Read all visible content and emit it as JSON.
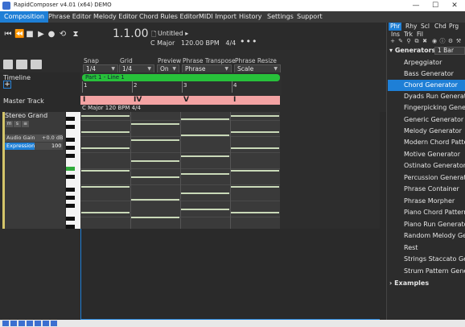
{
  "window": {
    "title": "RapidComposer v4.01 (x64) DEMO"
  },
  "menu": [
    {
      "label": "Composition"
    },
    {
      "label": "Phrase Editor"
    },
    {
      "label": "Melody Editor"
    },
    {
      "label": "Chord Rules Editor"
    },
    {
      "label": "MIDI Import"
    },
    {
      "label": "History"
    },
    {
      "label": "Settings"
    },
    {
      "label": "Support"
    }
  ],
  "transport": {
    "position": "1.1.00",
    "song_name": "Untitled",
    "key": "C Major",
    "tempo": "120.00 BPM",
    "time_signature": "4/4",
    "more": "•••"
  },
  "controls": {
    "snap": {
      "label": "Snap",
      "value": "1/4"
    },
    "grid": {
      "label": "Grid",
      "value": "1/4"
    },
    "preview": {
      "label": "Preview",
      "value": "On"
    },
    "phrase_transpose": {
      "label": "Phrase Transpose",
      "value": "Phrase"
    },
    "phrase_resize": {
      "label": "Phrase Resize",
      "value": "Scale"
    }
  },
  "timeline": {
    "label": "Timeline",
    "part_label": "Part 1 - Line 1",
    "bar_numbers": [
      "1",
      "2",
      "3",
      "4"
    ],
    "chords": [
      "I",
      "IV",
      "V",
      "I"
    ],
    "key_text": "C Major  120 BPM  4/4"
  },
  "track": {
    "master_label": "Master Track",
    "name": "Stereo Grand",
    "audio_gain_label": "Audio Gain",
    "audio_gain_value": "+0.0  dB",
    "expression_label": "Expression",
    "expression_value": "100",
    "expression_level_pct": 52
  },
  "right_panel": {
    "tabs": [
      "Phr",
      "Rhy",
      "Scl",
      "Chd",
      "Prg"
    ],
    "tabs2": [
      "Ins",
      "Trk",
      "Fil"
    ],
    "bar_select": "1 Bar",
    "generators_header": "Generators",
    "generators": [
      "Arpeggiator",
      "Bass Generator",
      "Chord Generator",
      "Dyads Run Generator",
      "Fingerpicking Generator",
      "Generic Generator",
      "Melody Generator",
      "Modern Chord Pattern",
      "Motive Generator",
      "Ostinato Generator",
      "Percussion Generator",
      "Phrase Container",
      "Phrase Morpher",
      "Piano Chord Pattern",
      "Piano Run Generator",
      "Random Melody Generator",
      "Rest",
      "Strings Staccato Generator",
      "Strum Pattern Generator"
    ],
    "selected_generator": "Chord Generator",
    "examples_label": "Examples"
  },
  "colors": {
    "accent": "#1e7fd6",
    "part_bar": "#27c13a",
    "chord_bar": "#f3a3a3",
    "note": "#c9d9b8"
  }
}
